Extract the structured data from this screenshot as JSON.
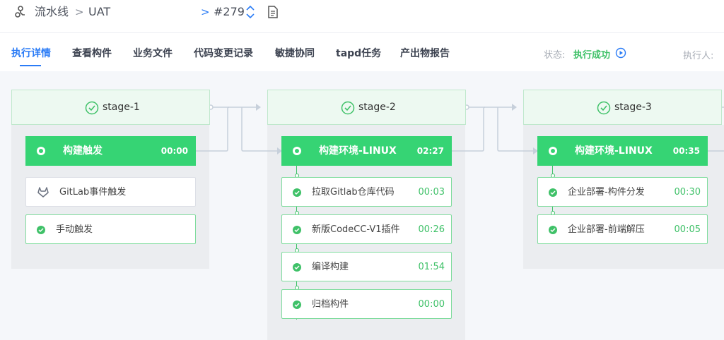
{
  "breadcrumb": {
    "root": "流水线",
    "pipeline": "UAT",
    "build": "#279"
  },
  "tabs": [
    "执行详情",
    "查看构件",
    "业务文件",
    "代码变更记录",
    "敏捷协同",
    "tapd任务",
    "产出物报告"
  ],
  "status": {
    "label": "状态:",
    "value": "执行成功"
  },
  "executor": {
    "label": "执行人:"
  },
  "stages": [
    {
      "title": "stage-1",
      "job": {
        "name": "构建触发",
        "time": "00:00"
      },
      "steps": [
        {
          "label": "GitLab事件触发",
          "icon": "gitlab-icon"
        },
        {
          "label": "手动触发",
          "icon": "check-icon"
        }
      ]
    },
    {
      "title": "stage-2",
      "job": {
        "name": "构建环境-LINUX",
        "time": "02:27"
      },
      "steps": [
        {
          "label": "拉取Gitlab仓库代码",
          "time": "00:03"
        },
        {
          "label": "新版CodeCC-V1插件",
          "time": "00:26"
        },
        {
          "label": "编译构建",
          "time": "01:54"
        },
        {
          "label": "归档构件",
          "time": "00:00"
        }
      ]
    },
    {
      "title": "stage-3",
      "job": {
        "name": "构建环境-LINUX",
        "time": "00:35"
      },
      "steps": [
        {
          "label": "企业部署-构件分发",
          "time": "00:30"
        },
        {
          "label": "企业部署-前端解压",
          "time": "00:05"
        }
      ]
    }
  ],
  "colors": {
    "accent": "#2b7cf6",
    "success": "#36d474",
    "success_text": "#3fc168"
  }
}
